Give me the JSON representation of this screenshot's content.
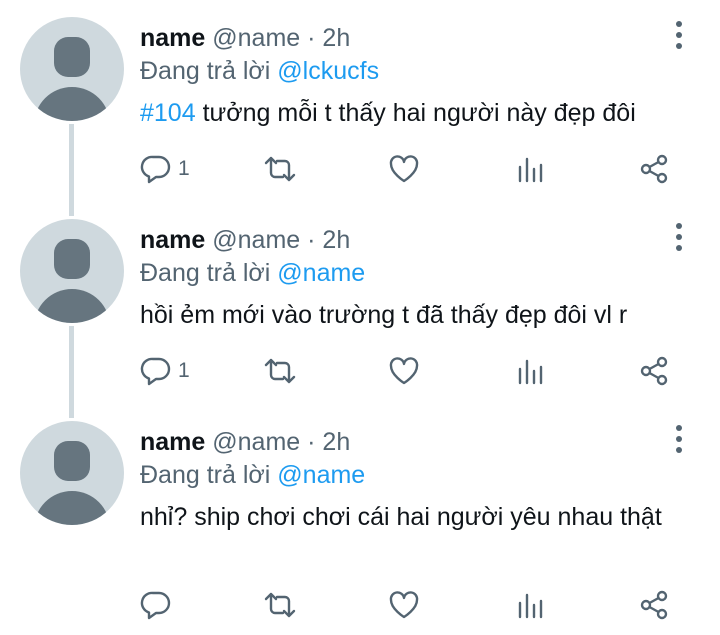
{
  "tweets": [
    {
      "name": "name",
      "handle": "@name",
      "dot": "·",
      "time": "2h",
      "reply_prefix": "Đang trả lời",
      "reply_to": "@lckucfs",
      "hashtag": "#104",
      "text": "tưởng mỗi t thấy hai người này đẹp đôi",
      "reply_count": "1"
    },
    {
      "name": "name",
      "handle": "@name",
      "dot": "·",
      "time": "2h",
      "reply_prefix": "Đang trả lời",
      "reply_to": "@name",
      "hashtag": "",
      "text": "hồi ẻm mới vào trường t đã thấy đẹp đôi vl r",
      "reply_count": "1"
    },
    {
      "name": "name",
      "handle": "@name",
      "dot": "·",
      "time": "2h",
      "reply_prefix": "Đang trả lời",
      "reply_to": "@name",
      "hashtag": "",
      "text": "nhỉ? ship chơi chơi cái hai người yêu nhau thật",
      "reply_count": ""
    }
  ],
  "icons": {
    "reply": "reply-icon",
    "retweet": "retweet-icon",
    "like": "heart-icon",
    "views": "analytics-icon",
    "share": "share-icon",
    "more": "more-vertical-icon"
  },
  "colors": {
    "link": "#1d9bf0",
    "secondary_text": "#536471",
    "primary_text": "#0f1419",
    "avatar_bg": "#cfd9de",
    "avatar_fg": "#66757f",
    "thread_line": "#cfd9de"
  }
}
